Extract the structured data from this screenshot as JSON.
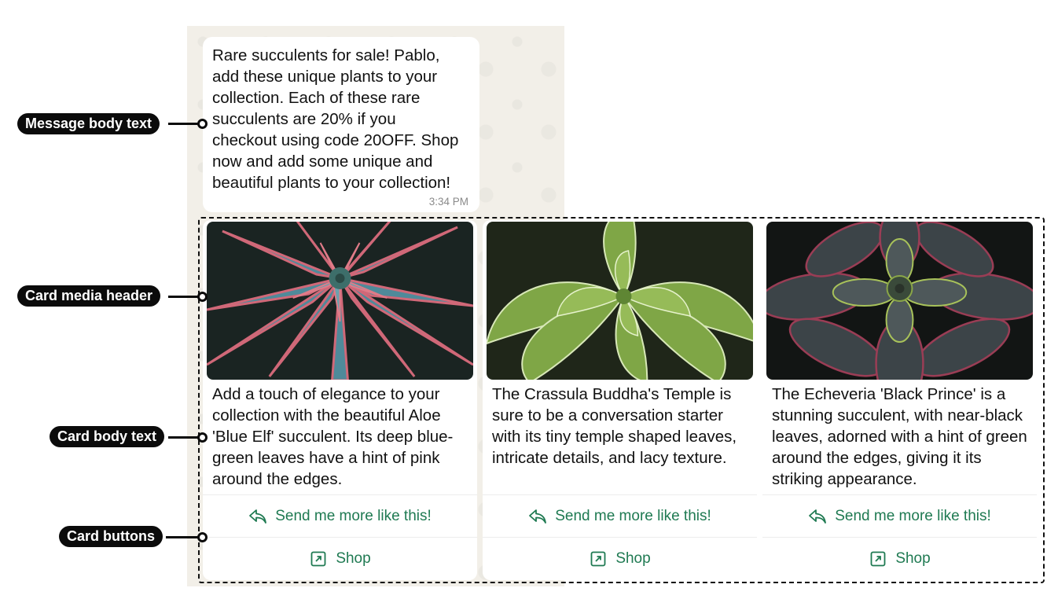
{
  "message": {
    "body": "Rare succulents for sale! Pablo,\nadd these unique plants to your\ncollection. Each of these rare\nsucculents are 20% if you\ncheckout using code 20OFF. Shop\nnow and add some unique and\nbeautiful plants to your collection!",
    "time": "3:34 PM"
  },
  "cards": [
    {
      "image_icon": "aloe-blue-elf-photo",
      "body": "Add a touch of elegance to your collection with the beautiful Aloe 'Blue Elf' succulent. Its deep blue-green leaves have a hint of pink around the edges.",
      "reply_label": "Send me more like this!",
      "shop_label": "Shop"
    },
    {
      "image_icon": "crassula-buddhas-temple-photo",
      "body": "The Crassula Buddha's Temple is sure to be a conversation starter with its tiny temple shaped leaves, intricate details, and lacy texture.",
      "reply_label": "Send me more like this!",
      "shop_label": "Shop"
    },
    {
      "image_icon": "echeveria-black-prince-photo",
      "body": "The Echeveria 'Black Prince' is a stunning succulent, with near-black leaves, adorned with a hint of green around the edges, giving it its striking appearance.",
      "reply_label": "Send me more like this!",
      "shop_label": "Shop"
    }
  ],
  "callouts": {
    "message_body": "Message body text",
    "media_header": "Card media header",
    "card_body": "Card body text",
    "card_buttons": "Card buttons"
  },
  "colors": {
    "button_text": "#1f7a52",
    "wallpaper": "#f2efe8",
    "callout_bg": "#0b0b0b"
  },
  "icons": {
    "reply": "reply-arrow-icon",
    "shop": "external-link-icon"
  }
}
